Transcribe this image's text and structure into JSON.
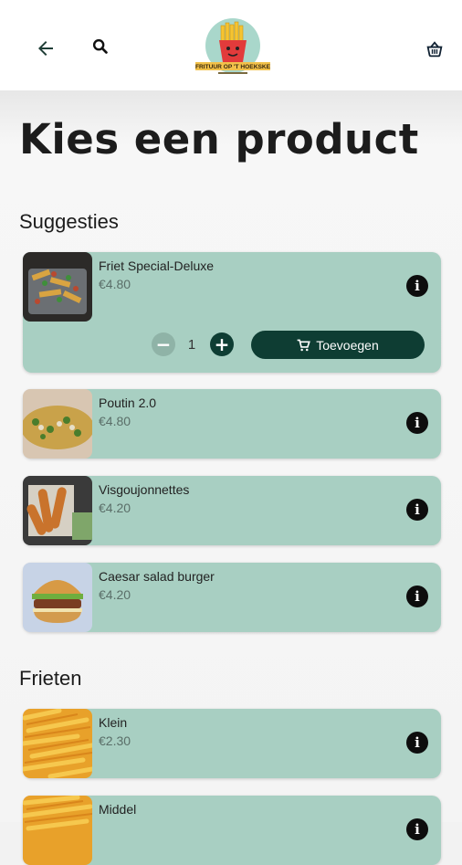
{
  "header": {
    "logo_text": "FRITUUR OP 'T HOEKSKE",
    "icons": {
      "back": "arrow-left-icon",
      "search": "search-icon",
      "cart": "basket-icon"
    }
  },
  "page": {
    "title": "Kies een product"
  },
  "sections": [
    {
      "title": "Suggesties",
      "items": [
        {
          "name": "Friet Special-Deluxe",
          "price": "€4.80",
          "quantity": "1",
          "add_label": "Toevoegen"
        },
        {
          "name": "Poutin 2.0",
          "price": "€4.80"
        },
        {
          "name": "Visgoujonnettes",
          "price": "€4.20"
        },
        {
          "name": "Caesar salad burger",
          "price": "€4.20"
        }
      ]
    },
    {
      "title": "Frieten",
      "items": [
        {
          "name": "Klein",
          "price": "€2.30"
        },
        {
          "name": "Middel",
          "price": ""
        }
      ]
    }
  ],
  "colors": {
    "card": "#a8cfc2",
    "accent": "#0e3d33",
    "header": "#ffffff"
  }
}
